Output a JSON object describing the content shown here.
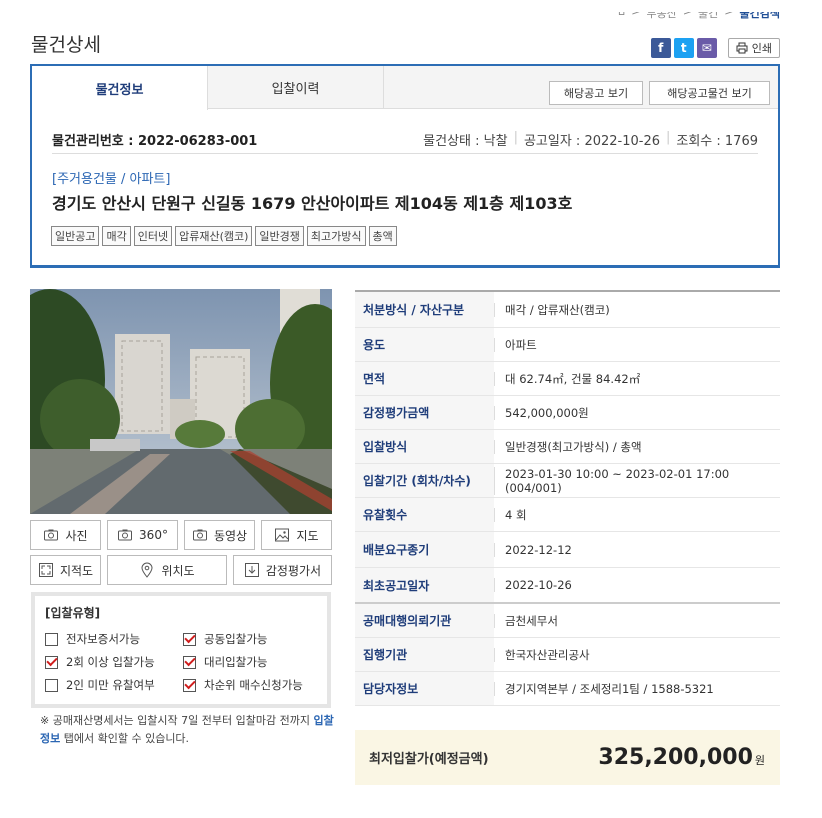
{
  "breadcrumb": {
    "items": [
      "⌂",
      "부동산",
      "물건"
    ],
    "current": "물건검색"
  },
  "page": {
    "title": "물건상세"
  },
  "share": {
    "facebook": "f",
    "twitter": "t",
    "mail": "✉",
    "print_label": "인쇄"
  },
  "tabs": [
    {
      "label": "물건정보"
    },
    {
      "label": "입찰이력"
    }
  ],
  "tab_buttons": {
    "notice": "해당공고 보기",
    "notice_items": "해당공고물건 보기"
  },
  "item": {
    "mgmt_no": "물건관리번호 : 2022-06283-001",
    "status": "물건상태 : 낙찰",
    "notice_date": "공고일자 : 2022-10-26",
    "views": "조회수 : 1769",
    "category": "[주거용건물 / 아파트]",
    "address": "경기도 안산시 단원구 신길동 1679 안산아이파트 제104동 제1층 제103호",
    "tags": [
      "일반공고",
      "매각",
      "인터넷",
      "압류재산(캠코)",
      "일반경쟁",
      "최고가방식",
      "총액"
    ]
  },
  "media_buttons": [
    {
      "label": "사진",
      "icon": "camera-icon"
    },
    {
      "label": "360°",
      "icon": "camera-icon"
    },
    {
      "label": "동영상",
      "icon": "camera-icon"
    },
    {
      "label": "지도",
      "icon": "map-image-icon"
    },
    {
      "label": "지적도",
      "icon": "expand-icon"
    },
    {
      "label": "위치도",
      "icon": "location-pin-icon"
    },
    {
      "label": "감정평가서",
      "icon": "download-icon"
    }
  ],
  "bid_type": {
    "title": "[입찰유형]",
    "options": [
      {
        "label": "전자보증서가능",
        "checked": false
      },
      {
        "label": "공동입찰가능",
        "checked": true
      },
      {
        "label": "2회 이상 입찰가능",
        "checked": true
      },
      {
        "label": "대리입찰가능",
        "checked": true
      },
      {
        "label": "2인 미만 유찰여부",
        "checked": false
      },
      {
        "label": "차순위 매수신청가능",
        "checked": true
      }
    ]
  },
  "note": {
    "pre": "※ 공매재산명세서는 입찰시작 7일 전부터 입찰마감 전까지 ",
    "link": "입찰정보",
    "post": " 탭에서 확인할 수 있습니다."
  },
  "details": {
    "group1": [
      {
        "label": "처분방식 / 자산구분",
        "value": "매각 / 압류재산(캠코)"
      },
      {
        "label": "용도",
        "value": "아파트"
      },
      {
        "label": "면적",
        "value": "대 62.74㎡, 건물 84.42㎡"
      },
      {
        "label": "감정평가금액",
        "value": "542,000,000원"
      },
      {
        "label": "입찰방식",
        "value": "일반경쟁(최고가방식) / 총액"
      },
      {
        "label": "입찰기간 (회차/차수)",
        "value": "2023-01-30 10:00 ~ 2023-02-01 17:00 (004/001)"
      },
      {
        "label": "유찰횟수",
        "value": "4 회"
      },
      {
        "label": "배분요구종기",
        "value": "2022-12-12"
      },
      {
        "label": "최초공고일자",
        "value": "2022-10-26"
      }
    ],
    "group2": [
      {
        "label": "공매대행의뢰기관",
        "value": "금천세무서"
      },
      {
        "label": "집행기관",
        "value": "한국자산관리공사"
      },
      {
        "label": "담당자정보",
        "value": "경기지역본부 / 조세정리1팀 / 1588-5321"
      }
    ]
  },
  "price": {
    "label": "최저입찰가(예정금액)",
    "value": "325,200,000",
    "unit": "원"
  }
}
